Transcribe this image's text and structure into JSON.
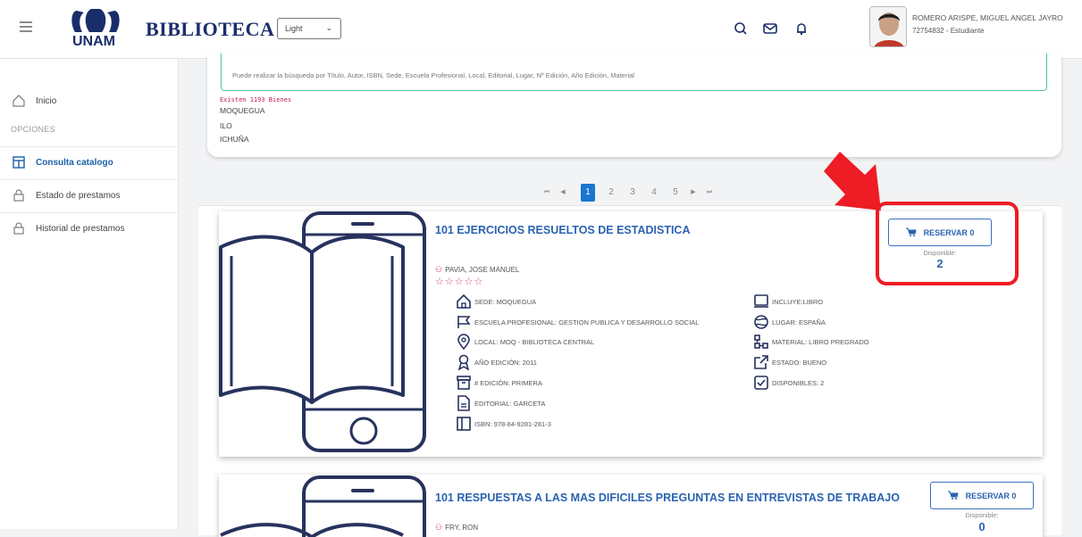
{
  "header": {
    "brand": "BIBLIOTECA",
    "logo_text": "UNAM",
    "theme_select": "Light",
    "user_name": "ROMERO ARISPE, MIGUEL ANGEL JAYRO",
    "user_role": "72754832 - Estudiante",
    "icons": [
      "menu-icon",
      "search-icon",
      "mail-icon",
      "bell-icon"
    ]
  },
  "sidebar": {
    "inicio": "Inicio",
    "section_label": "OPCIONES",
    "items": [
      "Consulta catalogo",
      "Estado de prestamos",
      "Historial de prestamos"
    ]
  },
  "search": {
    "hint": "Puede realizar la búsqueda por Título, Autor, ISBN, Sede, Escuela Profesional, Local, Editorial, Lugar, Nº Edición, Año Edición, Material",
    "existing": "Existen 1193 Bienes",
    "places": [
      "MOQUEGUA",
      "ILO",
      "ICHUÑA"
    ]
  },
  "pagination": {
    "first": "⏮",
    "prev": "◀",
    "pages": [
      "1",
      "2",
      "3",
      "4",
      "5"
    ],
    "current": "1",
    "next": "▶",
    "last": "⏭"
  },
  "results": [
    {
      "title": "101 EJERCICIOS RESUELTOS DE ESTADISTICA",
      "author": "PAVIA, JOSE MANUEL",
      "rating": "☆☆☆☆☆",
      "attrs_left": [
        "SEDE: MOQUEGUA",
        "ESCUELA PROFESIONAL: GESTION PUBLICA Y DESARROLLO SOCIAL",
        "LOCAL: MOQ - BIBLIOTECA CENTRAL",
        "AÑO EDICIÓN: 2011",
        "# EDICIÓN: PRIMERA",
        "EDITORIAL: GARCETA",
        "ISBN: 978-84-9281-281-3"
      ],
      "attrs_right": [
        "INCLUYE:LIBRO",
        "LUGAR: ESPAÑA",
        "MATERIAL: LIBRO PREGRADO",
        "ESTADO: BUENO",
        "DISPONIBLES: 2"
      ],
      "reserve_label": "RESERVAR 0",
      "available_label": "Disponible:",
      "available_value": "2"
    },
    {
      "title": "101 RESPUESTAS A LAS MAS DIFICILES PREGUNTAS EN ENTREVISTAS DE TRABAJO",
      "author": "FRY, RON",
      "reserve_label": "RESERVAR 0",
      "available_label": "Disponible:",
      "available_value": "0"
    }
  ],
  "colors": {
    "accent": "#2a63b0",
    "pink": "#d83c74",
    "annotation": "#ee1c24",
    "outline": "#27325e"
  }
}
